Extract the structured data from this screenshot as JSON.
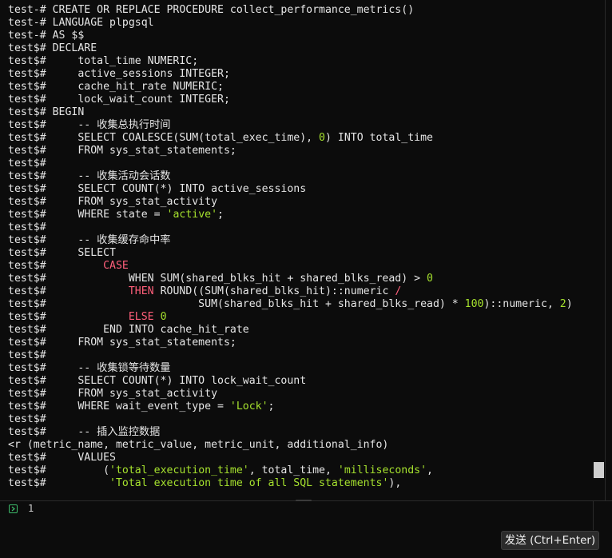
{
  "terminal": {
    "lines": [
      [
        {
          "t": "test-# "
        }
      ],
      [
        {
          "t": "test-# CREATE OR REPLACE PROCEDURE collect_performance_metrics()"
        }
      ],
      [
        {
          "t": "test-# LANGUAGE plpgsql"
        }
      ],
      [
        {
          "t": "test-# AS $$"
        }
      ],
      [
        {
          "t": "test$# DECLARE"
        }
      ],
      [
        {
          "t": "test$#     total_time NUMERIC;"
        }
      ],
      [
        {
          "t": "test$#     active_sessions INTEGER;"
        }
      ],
      [
        {
          "t": "test$#     cache_hit_rate NUMERIC;"
        }
      ],
      [
        {
          "t": "test$#     lock_wait_count INTEGER;"
        }
      ],
      [
        {
          "t": "test$# BEGIN"
        }
      ],
      [
        {
          "t": "test$#     -- 收集总执行时间"
        }
      ],
      [
        {
          "t": "test$#     SELECT COALESCE(SUM(total_exec_time), "
        },
        {
          "t": "0",
          "c": "num"
        },
        {
          "t": ") INTO total_time"
        }
      ],
      [
        {
          "t": "test$#     FROM sys_stat_statements;"
        }
      ],
      [
        {
          "t": "test$#"
        }
      ],
      [
        {
          "t": "test$#     -- 收集活动会话数"
        }
      ],
      [
        {
          "t": "test$#     SELECT COUNT(*) INTO active_sessions"
        }
      ],
      [
        {
          "t": "test$#     FROM sys_stat_activity"
        }
      ],
      [
        {
          "t": "test$#     WHERE state = "
        },
        {
          "t": "'active'",
          "c": "str"
        },
        {
          "t": ";"
        }
      ],
      [
        {
          "t": "test$#"
        }
      ],
      [
        {
          "t": "test$#     -- 收集缓存命中率"
        }
      ],
      [
        {
          "t": "test$#     SELECT"
        }
      ],
      [
        {
          "t": "test$#         "
        },
        {
          "t": "CASE",
          "c": "case"
        }
      ],
      [
        {
          "t": "test$#             WHEN SUM(shared_blks_hit + shared_blks_read) > "
        },
        {
          "t": "0",
          "c": "num"
        }
      ],
      [
        {
          "t": "test$#             "
        },
        {
          "t": "THEN",
          "c": "case"
        },
        {
          "t": " ROUND((SUM(shared_blks_hit)::numeric "
        },
        {
          "t": "/",
          "c": "case"
        }
      ],
      [
        {
          "t": "test$#                        SUM(shared_blks_hit + shared_blks_read) * "
        },
        {
          "t": "100",
          "c": "num"
        },
        {
          "t": ")::numeric, "
        },
        {
          "t": "2",
          "c": "num"
        },
        {
          "t": ")"
        }
      ],
      [
        {
          "t": "test$#             "
        },
        {
          "t": "ELSE",
          "c": "case"
        },
        {
          "t": " "
        },
        {
          "t": "0",
          "c": "num"
        }
      ],
      [
        {
          "t": "test$#         END INTO cache_hit_rate"
        }
      ],
      [
        {
          "t": "test$#     FROM sys_stat_statements;"
        }
      ],
      [
        {
          "t": "test$#"
        }
      ],
      [
        {
          "t": "test$#     -- 收集锁等待数量"
        }
      ],
      [
        {
          "t": "test$#     SELECT COUNT(*) INTO lock_wait_count"
        }
      ],
      [
        {
          "t": "test$#     FROM sys_stat_activity"
        }
      ],
      [
        {
          "t": "test$#     WHERE wait_event_type = "
        },
        {
          "t": "'Lock'",
          "c": "str"
        },
        {
          "t": ";"
        }
      ],
      [
        {
          "t": "test$#"
        }
      ],
      [
        {
          "t": "test$#     -- 插入监控数据"
        }
      ],
      [
        {
          "t": "<r (metric_name, metric_value, metric_unit, additional_info)"
        }
      ],
      [
        {
          "t": "test$#     VALUES"
        }
      ],
      [
        {
          "t": "test$#         ("
        },
        {
          "t": "'total_execution_time'",
          "c": "str"
        },
        {
          "t": ", total_time, "
        },
        {
          "t": "'milliseconds'",
          "c": "str"
        },
        {
          "t": ","
        }
      ],
      [
        {
          "t": "test$#          "
        },
        {
          "t": "'Total execution time of all SQL statements'",
          "c": "str"
        },
        {
          "t": "),"
        }
      ]
    ]
  },
  "input": {
    "line_number": "1",
    "prompt_icon": "chevron-right-icon"
  },
  "send_button": {
    "label": "发送 (Ctrl+Enter)"
  },
  "colors": {
    "background": "#0c0c0c",
    "text": "#e6e6e6",
    "string_literal": "#a6e22e",
    "keyword_case": "#ff5f7a",
    "prompt_icon": "#3dbb6a"
  }
}
